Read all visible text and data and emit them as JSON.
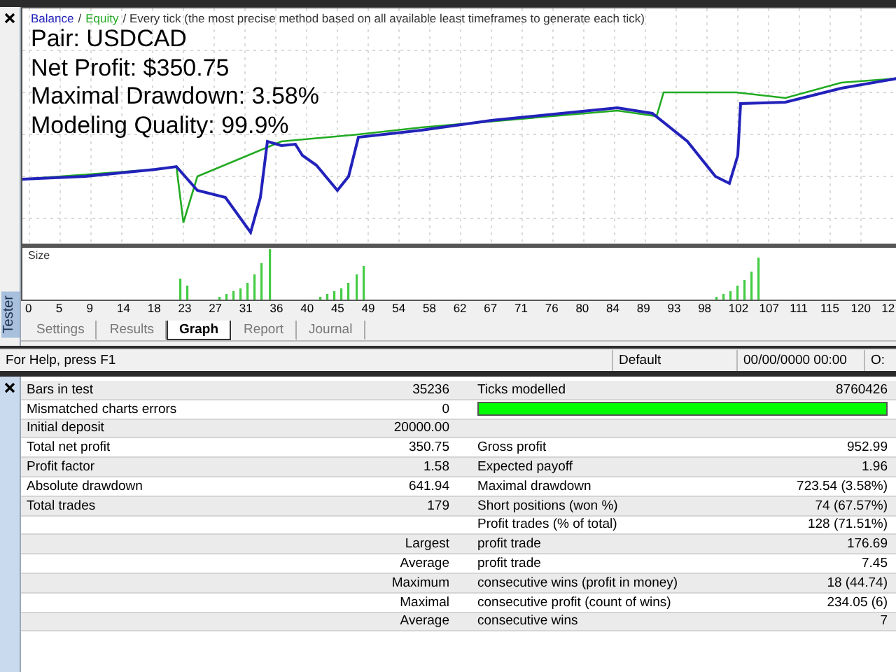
{
  "legend": [
    {
      "text": "Balance",
      "color": "#2222bb"
    },
    {
      "text": "/",
      "color": "#333333"
    },
    {
      "text": "Equity",
      "color": "#22aa22"
    },
    {
      "text": "/ Every tick (the most precise method based on all available least timeframes to generate each tick)",
      "color": "#333333"
    }
  ],
  "overlay": [
    "Pair: USDCAD",
    "Net Profit: $350.75",
    "Maximal Drawdown: 3.58%",
    "Modeling Quality: 99.9%"
  ],
  "size_label": "Size",
  "x_axis_labels": [
    "0",
    "5",
    "9",
    "14",
    "18",
    "23",
    "27",
    "31",
    "36",
    "40",
    "45",
    "49",
    "54",
    "58",
    "62",
    "67",
    "71",
    "76",
    "80",
    "84",
    "89",
    "93",
    "98",
    "102",
    "107",
    "111",
    "115",
    "120",
    "12"
  ],
  "side_label": "Tester",
  "tabs": [
    {
      "label": "Settings",
      "selected": false
    },
    {
      "label": "Results",
      "selected": false
    },
    {
      "label": "Graph",
      "selected": true
    },
    {
      "label": "Report",
      "selected": false
    },
    {
      "label": "Journal",
      "selected": false
    }
  ],
  "status_bar": [
    "For Help, press F1",
    "Default",
    "00/00/0000 00:00",
    "O:"
  ],
  "report": {
    "rows": [
      {
        "kind": "pair",
        "label": "Bars in test",
        "value": "35236",
        "label_2": "Ticks modelled",
        "value_2": "8760426"
      },
      {
        "kind": "quality",
        "label": "Mismatched charts errors",
        "value": "0",
        "level": 1
      },
      {
        "kind": "pair",
        "label": "Initial deposit",
        "value": "20000.00"
      },
      {
        "kind": "pair",
        "label": "Total net profit",
        "value": "350.75",
        "label_2": "Gross profit",
        "value_2": "952.99"
      },
      {
        "kind": "pair",
        "label": "Profit factor",
        "value": "1.58",
        "label_2": "Expected payoff",
        "value_2": "1.96"
      },
      {
        "kind": "pair",
        "label": "Absolute drawdown",
        "value": "641.94",
        "label_2": "Maximal drawdown",
        "value_2": "723.54 (3.58%)"
      },
      {
        "kind": "pair",
        "label": "Total trades",
        "value": "179",
        "label_2": "Short positions (won %)",
        "value_2": "74 (67.57%)"
      },
      {
        "kind": "pair",
        "label_2": "Profit trades (% of total)",
        "value_2": "128 (71.51%)"
      },
      {
        "kind": "detail",
        "label": "Largest",
        "label_2": "profit trade",
        "value_2": "176.69"
      },
      {
        "kind": "detail",
        "label": "Average",
        "label_2": "profit trade",
        "value_2": "7.45"
      },
      {
        "kind": "detail",
        "label": "Maximum",
        "label_2": "consecutive wins (profit in money)",
        "value_2": "18 (44.74)"
      },
      {
        "kind": "detail",
        "label": "Maximal",
        "label_2": "consecutive profit (count of wins)",
        "value_2": "234.05 (6)"
      },
      {
        "kind": "detail",
        "label": "Average",
        "label_2": "consecutive wins",
        "value_2": "7"
      }
    ]
  }
}
